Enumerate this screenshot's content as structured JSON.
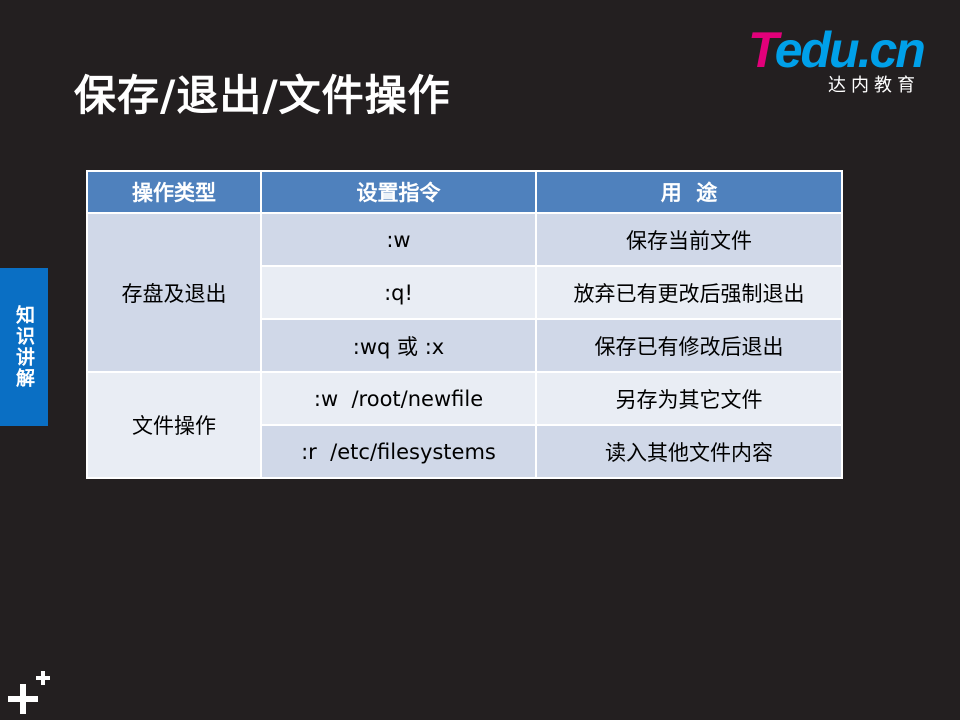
{
  "title": "保存/退出/文件操作",
  "logo": {
    "wordmark_first": "T",
    "wordmark_rest": "edu.cn",
    "subtitle": "达内教育",
    "colors": {
      "t": "#e2007a",
      "rest": "#00a0e9"
    }
  },
  "side_tab": {
    "label": "知识讲解",
    "color": "#0a6fc4"
  },
  "table": {
    "headers": [
      "操作类型",
      "设置指令",
      "用  途"
    ],
    "groups": [
      {
        "type": "存盘及退出",
        "rows": [
          {
            "command": ":w",
            "purpose": "保存当前文件"
          },
          {
            "command": ":q!",
            "purpose": "放弃已有更改后强制退出"
          },
          {
            "command": ":wq 或 :x",
            "purpose": "保存已有修改后退出"
          }
        ]
      },
      {
        "type": "文件操作",
        "rows": [
          {
            "command": ":w  /root/newfile",
            "purpose": "另存为其它文件"
          },
          {
            "command": ":r  /etc/filesystems",
            "purpose": "读入其他文件内容"
          }
        ]
      }
    ],
    "colors": {
      "header": "#4f81bd",
      "band_dark": "#d0d8e8",
      "band_light": "#e9edf4"
    }
  },
  "background_color": "#231f20",
  "footer_icon": "plus-plus-icon"
}
